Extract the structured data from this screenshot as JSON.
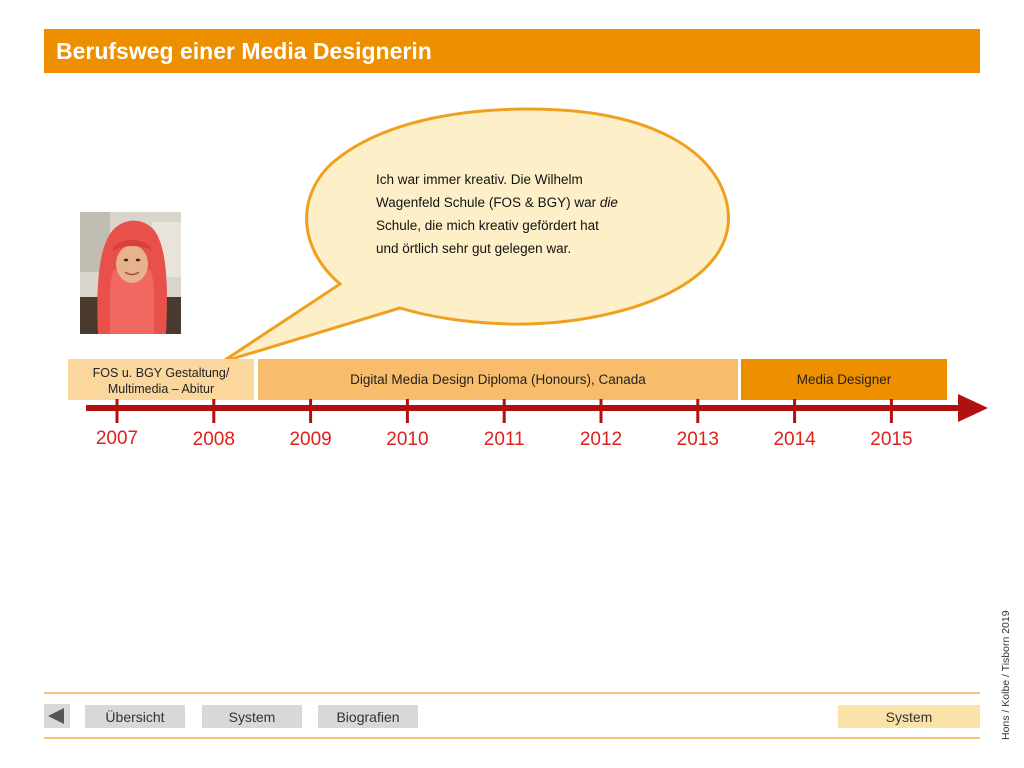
{
  "header": {
    "title": "Berufsweg einer Media Designerin"
  },
  "photo": {
    "icon": "portrait-photo"
  },
  "speech_bubble": {
    "lines": [
      [
        "Ich war immer kreativ. Die Wilhelm"
      ],
      [
        "Wagenfeld Schule (FOS & BGY) war ",
        "die"
      ],
      [
        "Schule, die mich kreativ gefördert hat"
      ],
      [
        "und örtlich sehr gut gelegen war."
      ]
    ],
    "line1": "Ich war immer kreativ. Die Wilhelm",
    "line2_a": "Wagenfeld Schule (FOS & BGY) war ",
    "line2_b": "die",
    "line3": "Schule, die mich kreativ gefördert hat",
    "line4": "und örtlich sehr gut gelegen war."
  },
  "phases": [
    {
      "line1": "FOS u. BGY Gestaltung/",
      "line2": "Multimedia – Abitur"
    },
    {
      "label": "Digital Media Design Diploma (Honours), Canada"
    },
    {
      "label": "Media Designer"
    }
  ],
  "timeline": {
    "years": [
      "2007",
      "2008",
      "2009",
      "2010",
      "2011",
      "2012",
      "2013",
      "2014",
      "2015"
    ],
    "color": "#b01010",
    "year_color": "#e0201a"
  },
  "credit": "Hons / Kolbe / Tisborn 2019",
  "footer": {
    "back_icon": "triangle-left-icon",
    "overview": "Übersicht",
    "system": "System",
    "biographies": "Biografien",
    "system_right": "System"
  },
  "colors": {
    "accent": "#ee8f00",
    "phase1": "#fbd79e",
    "phase2": "#f8bd6c",
    "phase3": "#ee8f00",
    "bubble_fill": "#fdf0c8",
    "bubble_stroke": "#f0a020"
  }
}
